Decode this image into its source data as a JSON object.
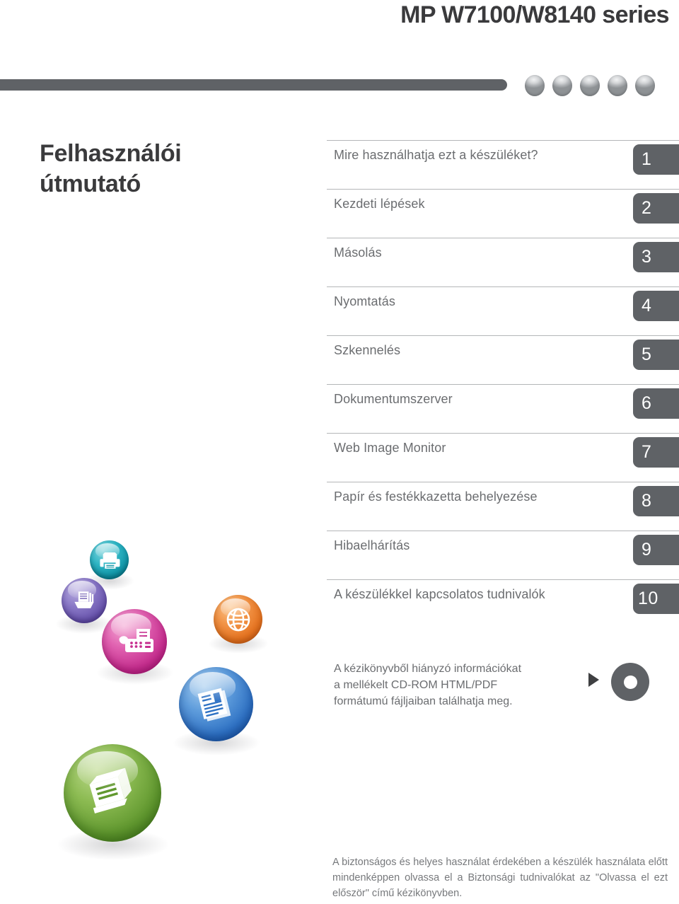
{
  "header": {
    "model_title": "MP W7100/W8140 series",
    "decor_dots": [
      "dot-1",
      "dot-2",
      "dot-3",
      "dot-4",
      "dot-5"
    ]
  },
  "guide": {
    "title_line1": "Felhasználói",
    "title_line2": "útmutató"
  },
  "toc": {
    "items": [
      {
        "label": "Mire használhatja ezt a készüléket?",
        "number": "1"
      },
      {
        "label": "Kezdeti lépések",
        "number": "2"
      },
      {
        "label": "Másolás",
        "number": "3"
      },
      {
        "label": "Nyomtatás",
        "number": "4"
      },
      {
        "label": "Szkennelés",
        "number": "5"
      },
      {
        "label": "Dokumentumszerver",
        "number": "6"
      },
      {
        "label": "Web Image Monitor",
        "number": "7"
      },
      {
        "label": "Papír és festékkazetta behelyezése",
        "number": "8"
      },
      {
        "label": "Hibaelhárítás",
        "number": "9"
      },
      {
        "label": "A készülékkel kapcsolatos tudnivalók",
        "number": "10"
      }
    ]
  },
  "cd_note": {
    "text": "A kézikönyvből hiányzó információkat a mellékelt CD-ROM HTML/PDF formátumú fájljaiban találhatja meg.",
    "arrow_icon": "triangle-right-icon",
    "disc_icon": "cd-rom-disc-icon"
  },
  "footer": {
    "text": "A biztonságos és helyes használat érdekében a készülék használata előtt mindenképpen olvassa el a Biztonsági tudnivalókat az \"Olvassa el ezt először\" című kézikönyvben."
  },
  "decor_bubbles": [
    {
      "id": "bub-printer",
      "icon": "printer-icon",
      "color": "#0f93a5"
    },
    {
      "id": "bub-docbox",
      "icon": "document-tray-icon",
      "color": "#6a56ae"
    },
    {
      "id": "bub-fax",
      "icon": "fax-machine-icon",
      "color": "#c62f8f"
    },
    {
      "id": "bub-globe",
      "icon": "globe-icon",
      "color": "#e57320"
    },
    {
      "id": "bub-doc",
      "icon": "document-pages-icon",
      "color": "#2f72c4"
    },
    {
      "id": "bub-scan",
      "icon": "scanner-icon",
      "color": "#61982f"
    }
  ],
  "colors": {
    "bar_gray": "#5f6266",
    "title_gray": "#3a3a3c",
    "text_gray": "#6b6d70",
    "rule_gray": "#b4b6b8"
  }
}
